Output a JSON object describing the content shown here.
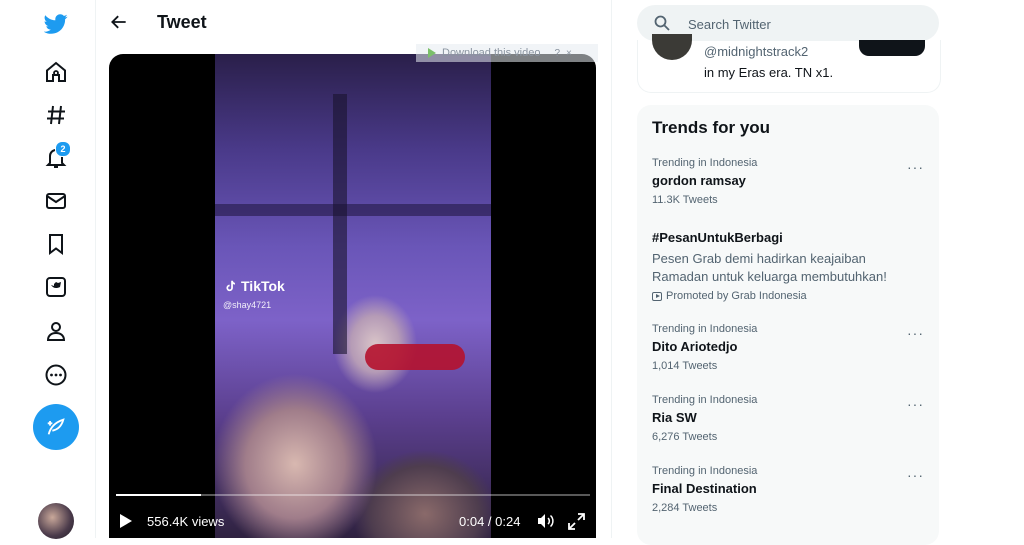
{
  "nav": {
    "notifications_badge": "2",
    "icons": [
      "twitter-logo-icon",
      "home-icon",
      "explore-hashtag-icon",
      "notifications-bell-icon",
      "messages-envelope-icon",
      "bookmarks-icon",
      "twitter-blue-icon",
      "profile-icon",
      "more-circle-icon",
      "compose-tweet-icon"
    ]
  },
  "header": {
    "title": "Tweet"
  },
  "video": {
    "overlay_download": "Download this video",
    "overlay_help": "?",
    "overlay_close": "×",
    "watermark_logo": "TikTok",
    "watermark_user": "@shay4721",
    "views": "556.4K views",
    "time": "0:04 / 0:24",
    "progress_fraction": 0.18
  },
  "search": {
    "placeholder": "Search Twitter"
  },
  "suggestion": {
    "handle": "@midnightstrack2",
    "bio": "in my Eras era. TN x1."
  },
  "trends": {
    "title": "Trends for you",
    "items": [
      {
        "category": "Trending in Indonesia",
        "name": "gordon ramsay",
        "count": "11.3K Tweets",
        "more": "···"
      },
      {
        "name": "#PesanUntukBerbagi",
        "description": "Pesen Grab demi hadirkan keajaiban Ramadan untuk keluarga membutuhkan!",
        "promoted": "Promoted by Grab Indonesia"
      },
      {
        "category": "Trending in Indonesia",
        "name": "Dito Ariotedjo",
        "count": "1,014 Tweets",
        "more": "···"
      },
      {
        "category": "Trending in Indonesia",
        "name": "Ria SW",
        "count": "6,276 Tweets",
        "more": "···"
      },
      {
        "category": "Trending in Indonesia",
        "name": "Final Destination",
        "count": "2,284 Tweets",
        "more": "···"
      }
    ]
  },
  "colors": {
    "accent": "#1d9bf0",
    "text": "#0f1419",
    "muted": "#536471",
    "panel": "#f7f9f9"
  }
}
